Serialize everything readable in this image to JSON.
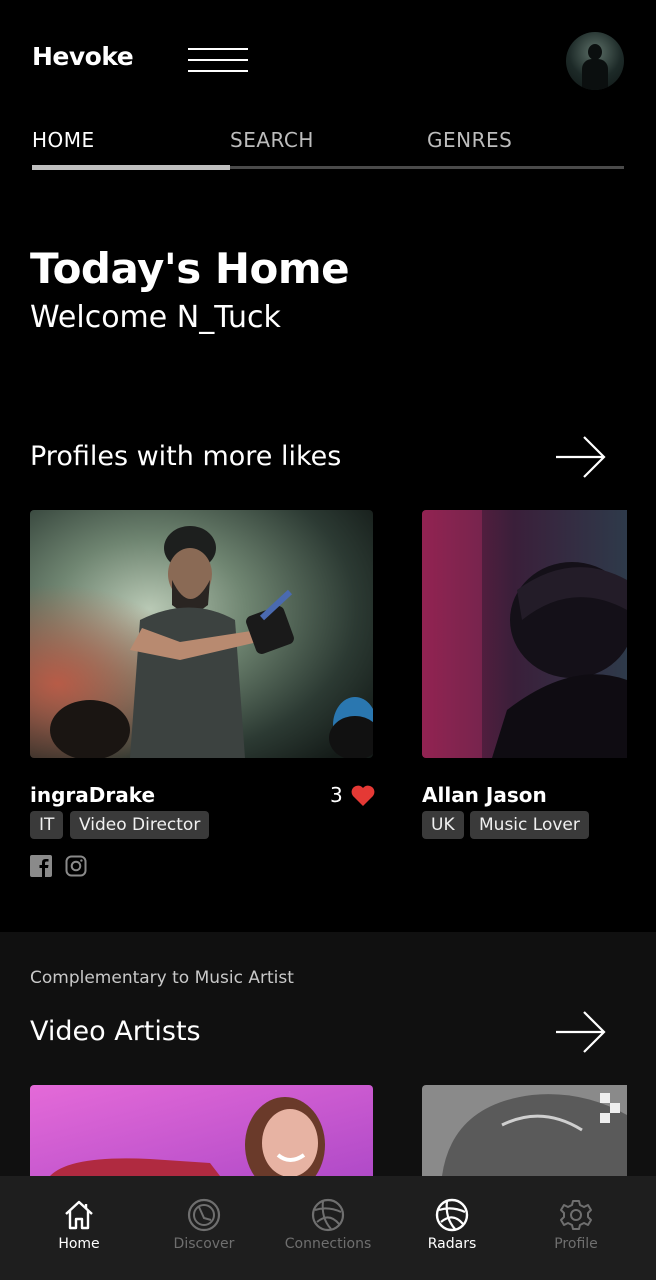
{
  "app": {
    "name": "Hevoke"
  },
  "colors": {
    "background": "#000000",
    "heart": "#e53935",
    "tag_bg": "#3a3a3a"
  },
  "tabs": [
    {
      "label": "HOME",
      "active": true
    },
    {
      "label": "SEARCH",
      "active": false
    },
    {
      "label": "GENRES",
      "active": false
    }
  ],
  "page": {
    "title": "Today's Home",
    "welcome": "Welcome N_Tuck"
  },
  "liked_section": {
    "title": "Profiles with more likes",
    "profiles": [
      {
        "name": "ingraDrake",
        "tags": [
          "IT",
          "Video Director"
        ],
        "likes": "3",
        "social": [
          "facebook-icon",
          "instagram-icon"
        ]
      },
      {
        "name": "Allan Jason",
        "tags": [
          "UK",
          "Music Lover"
        ]
      }
    ]
  },
  "video_section": {
    "subtitle": "Complementary to Music Artist",
    "title": "Video Artists"
  },
  "bottom_nav": [
    {
      "label": "Home",
      "icon": "home-icon",
      "active": true
    },
    {
      "label": "Discover",
      "icon": "discover-icon",
      "active": false
    },
    {
      "label": "Connections",
      "icon": "connections-icon",
      "active": false
    },
    {
      "label": "Radars",
      "icon": "radars-icon",
      "active": true
    },
    {
      "label": "Profile",
      "icon": "gear-icon",
      "active": false
    }
  ]
}
